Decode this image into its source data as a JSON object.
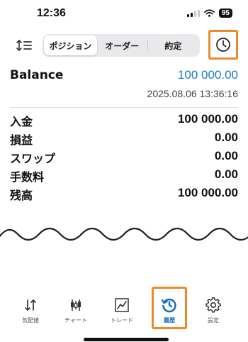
{
  "status": {
    "time": "12:36",
    "battery": "95"
  },
  "toolbar": {
    "tabs": [
      {
        "label": "ポジション",
        "active": true
      },
      {
        "label": "オーダー",
        "active": false
      },
      {
        "label": "約定",
        "active": false
      }
    ]
  },
  "account": {
    "balance_label": "Balance",
    "balance_value": "100 000.00",
    "timestamp": "2025.08.06 13:36:16"
  },
  "summary": [
    {
      "label": "入金",
      "value": "100 000.00"
    },
    {
      "label": "損益",
      "value": "0.00"
    },
    {
      "label": "スワップ",
      "value": "0.00"
    },
    {
      "label": "手数料",
      "value": "0.00"
    },
    {
      "label": "残高",
      "value": "100 000.00"
    }
  ],
  "tabbar": {
    "items": [
      {
        "label": "気配値",
        "icon": "quotes-icon",
        "active": false
      },
      {
        "label": "チャート",
        "icon": "chart-icon",
        "active": false
      },
      {
        "label": "トレード",
        "icon": "trade-icon",
        "active": false
      },
      {
        "label": "履歴",
        "icon": "history-icon",
        "active": true
      },
      {
        "label": "設定",
        "icon": "settings-icon",
        "active": false
      }
    ]
  },
  "colors": {
    "accent": "#1a7fc8",
    "highlight": "#ee8a2c",
    "active_tab": "#1a6fc4"
  }
}
